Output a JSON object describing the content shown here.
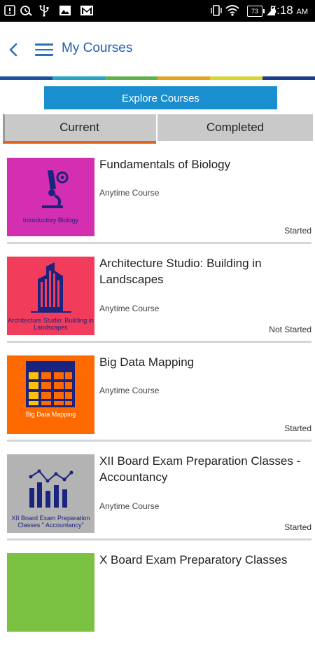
{
  "status_bar": {
    "time": "5:18",
    "ampm": "AM",
    "battery": "73",
    "icons": [
      "alert-icon",
      "sync-icon",
      "usb-icon",
      "image-icon",
      "gmail-icon",
      "vibrate-icon",
      "wifi-icon",
      "signal-icon",
      "battery-icon"
    ]
  },
  "header": {
    "title": "My Courses",
    "back_icon": "chevron-left-icon",
    "menu_icon": "hamburger-icon"
  },
  "brand_stripes": [
    "#1c4f9c",
    "#23a6c4",
    "#5fb24a",
    "#e3a51b",
    "#d5d631",
    "#1c3e8c"
  ],
  "explore_button": "Explore Courses",
  "tabs": {
    "current": "Current",
    "completed": "Completed"
  },
  "courses": [
    {
      "title": "Fundamentals of Biology",
      "thumb_label": "Introductory Biology",
      "type": "Anytime Course",
      "status": "Started",
      "thumb_color": "#d42fb0",
      "icon": "microscope-icon"
    },
    {
      "title": "Architecture Studio: Building in Landscapes",
      "thumb_label": "Architecture Studio: Building in Landscapes",
      "type": "Anytime Course",
      "status": "Not Started",
      "thumb_color": "#f23c5c",
      "icon": "building-icon"
    },
    {
      "title": "Big Data Mapping",
      "thumb_label": "Big Data Mapping",
      "type": "Anytime Course",
      "status": "Started",
      "thumb_color": "#ff6a00",
      "icon": "table-grid-icon"
    },
    {
      "title": "XII Board Exam Preparation Classes - Accountancy",
      "thumb_label": "XII Board Exam  Preparation Classes \" Accountancy\"",
      "type": "Anytime Course",
      "status": "Started",
      "thumb_color": "#b3b3b3",
      "icon": "bar-chart-icon"
    },
    {
      "title": "X Board Exam Preparatory Classes",
      "thumb_label": "",
      "type": "",
      "status": "",
      "thumb_color": "#7cc242",
      "icon": ""
    }
  ]
}
